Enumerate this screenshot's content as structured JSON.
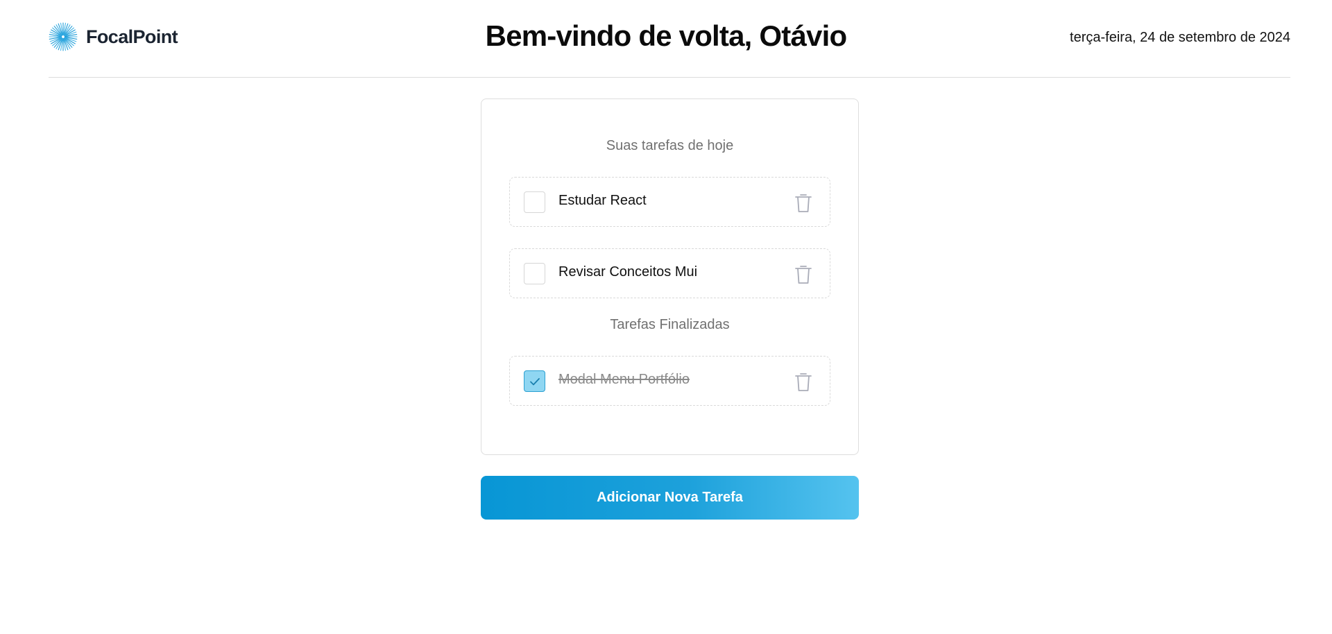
{
  "brand": {
    "name": "FocalPoint",
    "logo_icon": "starburst-logo",
    "accent_color": "#2a9fd1"
  },
  "header": {
    "welcome": "Bem-vindo de volta, Otávio",
    "date": "terça-feira, 24 de setembro de 2024"
  },
  "tasks": {
    "today_title": "Suas tarefas de hoje",
    "today": [
      {
        "label": "Estudar React",
        "checked": false
      },
      {
        "label": "Revisar Conceitos Mui",
        "checked": false
      }
    ],
    "done_title": "Tarefas Finalizadas",
    "done": [
      {
        "label": "Modal Menu Portfólio",
        "checked": true
      }
    ]
  },
  "actions": {
    "add_task_label": "Adicionar Nova Tarefa"
  },
  "icons": {
    "delete": "trash-icon",
    "check": "check-icon"
  },
  "colors": {
    "button_gradient_start": "#0896d5",
    "button_gradient_end": "#55c3ef",
    "checked_fill": "#8fd6f2"
  }
}
